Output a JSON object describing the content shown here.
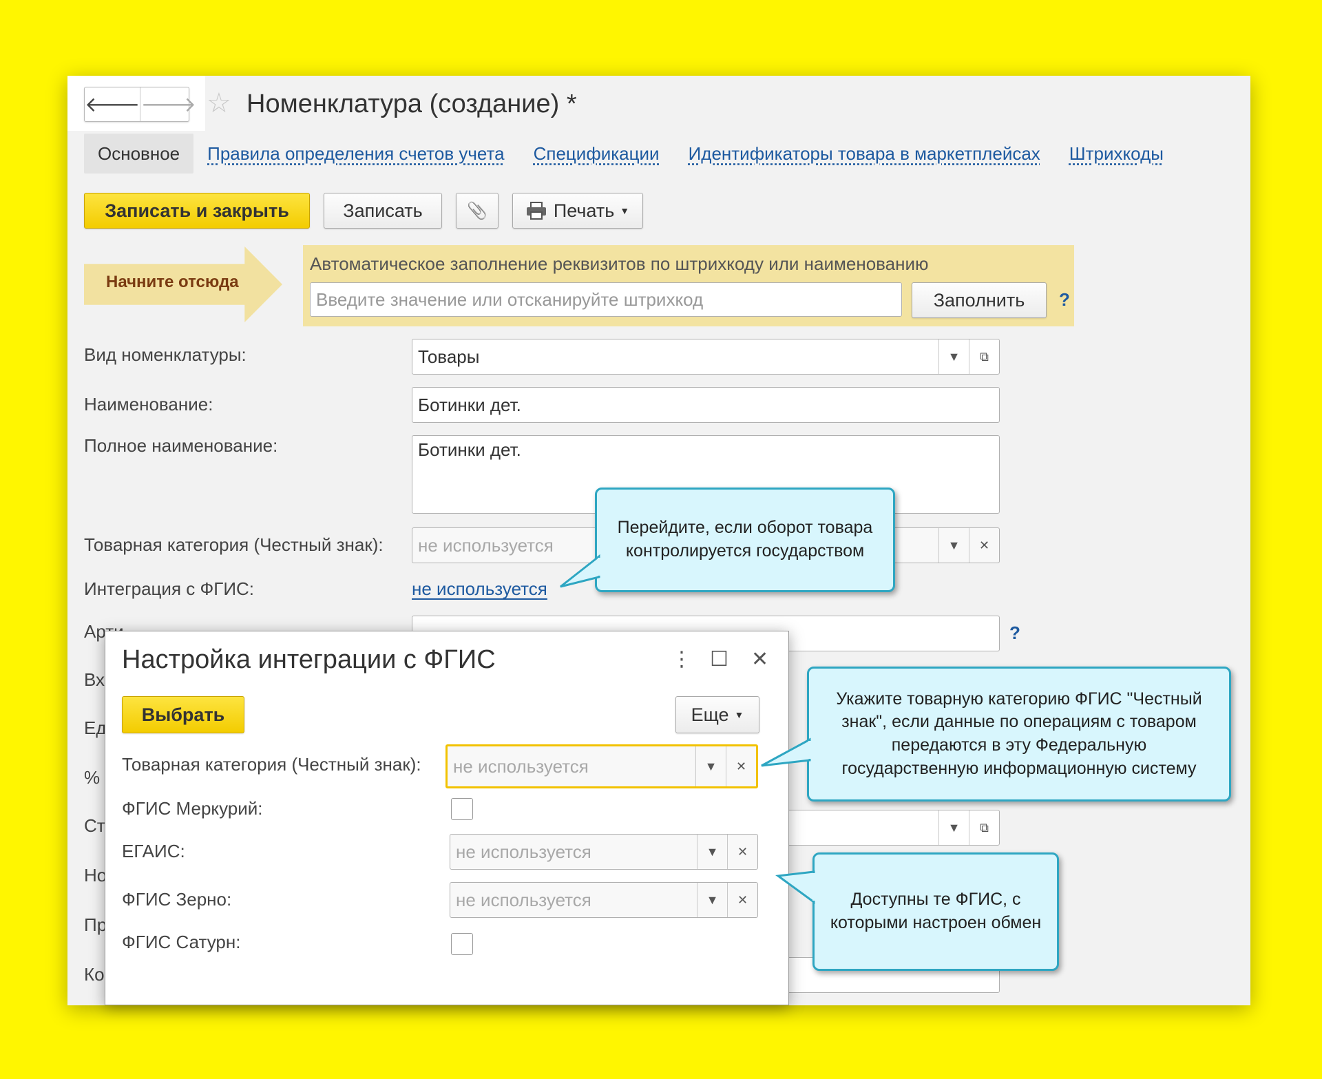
{
  "window": {
    "title": "Номенклатура (создание) *",
    "nav_back": "🡐",
    "nav_forward": "🡒",
    "favorite_star": "☆"
  },
  "tabs": [
    {
      "label": "Основное"
    },
    {
      "label": "Правила определения счетов учета"
    },
    {
      "label": "Спецификации"
    },
    {
      "label": "Идентификаторы товара в маркетплейсах"
    },
    {
      "label": "Штрихкоды"
    }
  ],
  "toolbar": {
    "save_close": "Записать и закрыть",
    "save": "Записать",
    "attach_icon": "📎",
    "print": "Печать"
  },
  "start_here": {
    "label": "Начните отсюда",
    "autofill_label": "Автоматическое заполнение реквизитов по штрихкоду или наименованию",
    "placeholder": "Введите значение или отсканируйте штрихкод",
    "fill_button": "Заполнить",
    "help": "?"
  },
  "form": {
    "kind_label": "Вид номенклатуры:",
    "kind_value": "Товары",
    "name_label": "Наименование:",
    "name_value": "Ботинки дет.",
    "fullname_label": "Полное наименование:",
    "fullname_value": "Ботинки дет.",
    "category_label": "Товарная категория (Честный знак):",
    "category_value": "не используется",
    "fgis_label": "Интеграция с ФГИС:",
    "fgis_link": "не используется",
    "article_label": "Арти",
    "article_help": "?",
    "partial_labels": [
      "Вх",
      "Ед",
      "%",
      "Ст",
      "Но",
      "Пр",
      "Ко"
    ]
  },
  "dialog": {
    "title": "Настройка интеграции с ФГИС",
    "more_icon": "⋮",
    "maximize_icon": "☐",
    "close_icon": "✕",
    "select_button": "Выбрать",
    "more_button": "Еще",
    "rows": {
      "honest_sign_label": "Товарная категория (Честный знак):",
      "honest_sign_value": "не используется",
      "mercury_label": "ФГИС Меркурий:",
      "egais_label": "ЕГАИС:",
      "egais_value": "не используется",
      "grain_label": "ФГИС Зерно:",
      "grain_value": "не используется",
      "saturn_label": "ФГИС Сатурн:"
    }
  },
  "callouts": {
    "c1": "Перейдите, если оборот товара контролируется государством",
    "c2": "Укажите товарную категорию ФГИС \"Честный знак\", если данные по операциям с товаром передаются в эту Федеральную государственную информационную систему",
    "c3": "Доступны те ФГИС, с которыми настроен обмен"
  },
  "colors": {
    "background": "#fff600",
    "primary_button": "#f3cc00",
    "link": "#1e5aa0",
    "callout_fill": "#d8f6fd",
    "callout_border": "#2ea6c2",
    "autofill_panel": "#f3e3a1"
  }
}
